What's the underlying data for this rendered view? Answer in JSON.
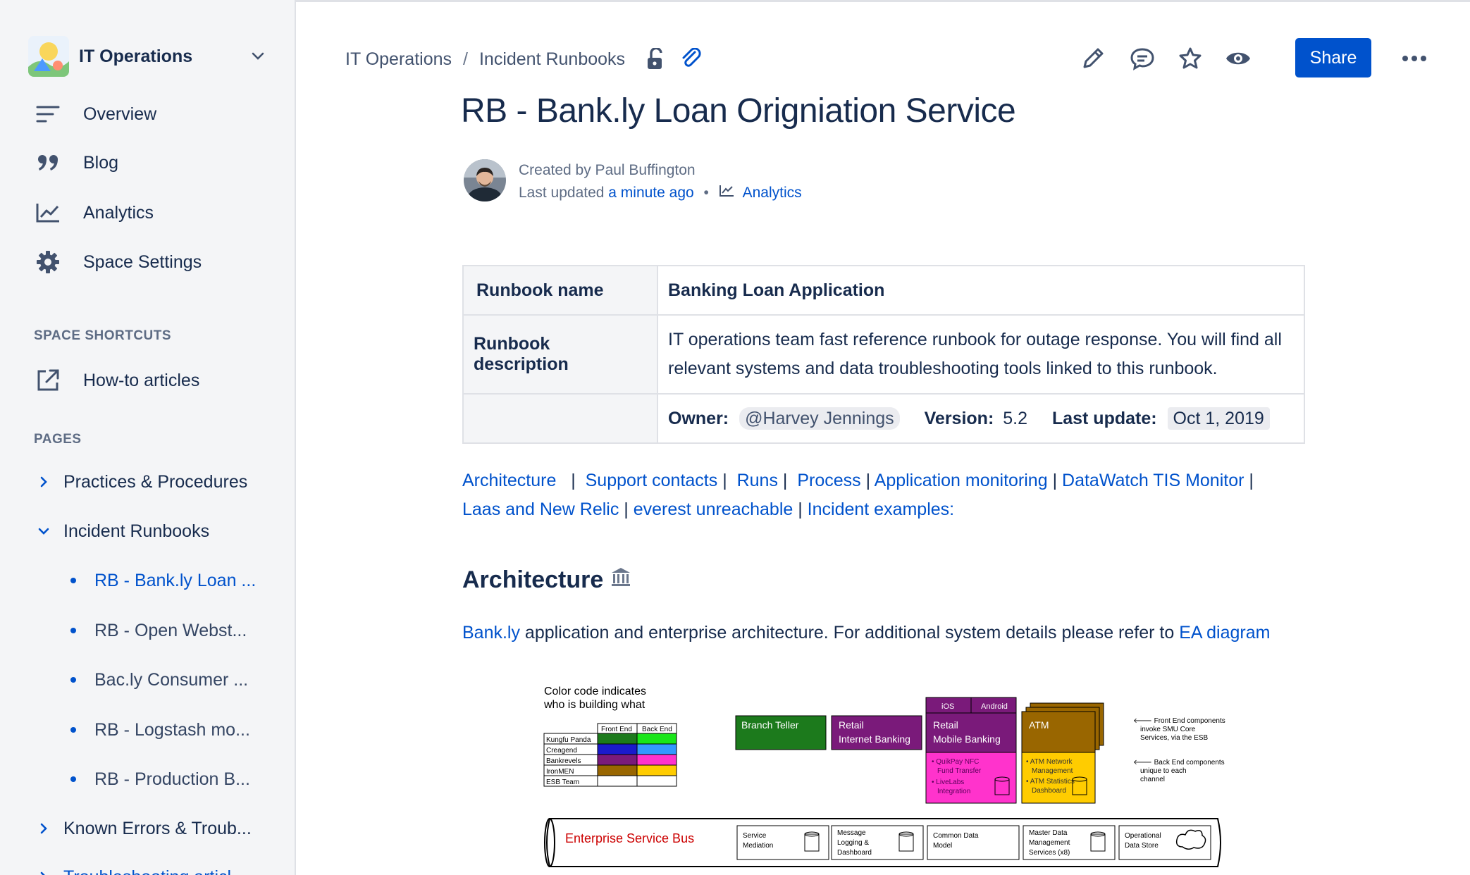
{
  "sidebar": {
    "space_name": "IT Operations",
    "nav": [
      {
        "label": "Overview",
        "icon": "overview-icon"
      },
      {
        "label": "Blog",
        "icon": "quote-icon"
      },
      {
        "label": "Analytics",
        "icon": "analytics-icon"
      },
      {
        "label": "Space Settings",
        "icon": "gear-icon"
      }
    ],
    "shortcuts_title": "SPACE SHORTCUTS",
    "shortcut": {
      "label": "How-to articles",
      "icon": "external-link-icon"
    },
    "pages_title": "PAGES",
    "pages": [
      {
        "label": "Practices & Procedures",
        "expanded": false
      },
      {
        "label": "Incident Runbooks",
        "expanded": true
      },
      {
        "label": "Known Errors & Troub...",
        "expanded": false
      },
      {
        "label": "Troubleshooting articl...",
        "expanded": false
      }
    ],
    "children": [
      {
        "label": "RB - Bank.ly Loan ...",
        "active": true
      },
      {
        "label": "RB - Open Webst...",
        "active": false
      },
      {
        "label": "Bac.ly Consumer ...",
        "active": false
      },
      {
        "label": "RB - Logstash mo...",
        "active": false
      },
      {
        "label": "RB - Production B...",
        "active": false
      }
    ]
  },
  "breadcrumb": {
    "items": [
      "IT Operations",
      "Incident Runbooks"
    ],
    "separator": "/"
  },
  "toolbar": {
    "share_label": "Share"
  },
  "page": {
    "title": "RB - Bank.ly Loan Origniation Service",
    "created_by": "Created by Paul Buffington",
    "last_updated_prefix": "Last updated",
    "last_updated_time": "a minute ago",
    "analytics_link": "Analytics"
  },
  "runbook": {
    "name_label": "Runbook name",
    "name_value": "Banking Loan Application",
    "desc_label": "Runbook description",
    "desc_value": "IT operations team fast reference runbook for outage response. You will find all relevant systems and data troubleshooting tools linked to this runbook.",
    "owner_label": "Owner:",
    "owner_value": "@Harvey Jennings",
    "version_label": "Version:",
    "version_value": "5.2",
    "lastupdate_label": "Last update:",
    "lastupdate_value": "Oct 1, 2019"
  },
  "links": [
    "Architecture",
    "Support contacts",
    "Runs",
    "Process",
    "Application monitoring",
    "DataWatch TIS Monitor",
    "Laas and New Relic",
    "everest unreachable",
    "Incident examples:"
  ],
  "architecture": {
    "heading": "Architecture",
    "intro_link": "Bank.ly",
    "intro_text": " application and enterprise architecture. For additional system details please refer to ",
    "ea_link": "EA diagram"
  },
  "diagram": {
    "legend_title_1": "Color code indicates",
    "legend_title_2": "who is building what",
    "legend_col_front": "Front End",
    "legend_col_back": "Back End",
    "teams": [
      "Kungfu Panda",
      "Creagend",
      "Bankrevels",
      "IronMEN",
      "ESB Team"
    ],
    "branch_teller": "Branch Teller",
    "retail_ib_1": "Retail",
    "retail_ib_2": "Internet Banking",
    "ios": "iOS",
    "android": "Android",
    "retail_mb_1": "Retail",
    "retail_mb_2": "Mobile Banking",
    "mb_items": [
      "• QuikPay NFC",
      "Fund Transfer",
      "• LiveLabs",
      "Integration"
    ],
    "atm": "ATM",
    "atm_items": [
      "• ATM Network",
      "Management",
      "• ATM Statistics",
      "Dashboard"
    ],
    "note_front_1": "🡐 Front End components",
    "note_front_2": "invoke SMU Core",
    "note_front_3": "Services, via the ESB",
    "note_back_1": "🡐 Back End components",
    "note_back_2": "unique to each",
    "note_back_3": "channel",
    "esb": "Enterprise Service Bus",
    "esb_boxes": [
      [
        "Service",
        "Mediation"
      ],
      [
        "Message",
        "Logging &",
        "Dashboard"
      ],
      [
        "Common Data",
        "Model"
      ],
      [
        "Master Data",
        "Management",
        "Services (x8)"
      ],
      [
        "Operational",
        "Data Store"
      ]
    ]
  },
  "colors": {
    "accent": "#0052CC",
    "text": "#172B4D",
    "sidebar_bg": "#F4F5F7"
  }
}
